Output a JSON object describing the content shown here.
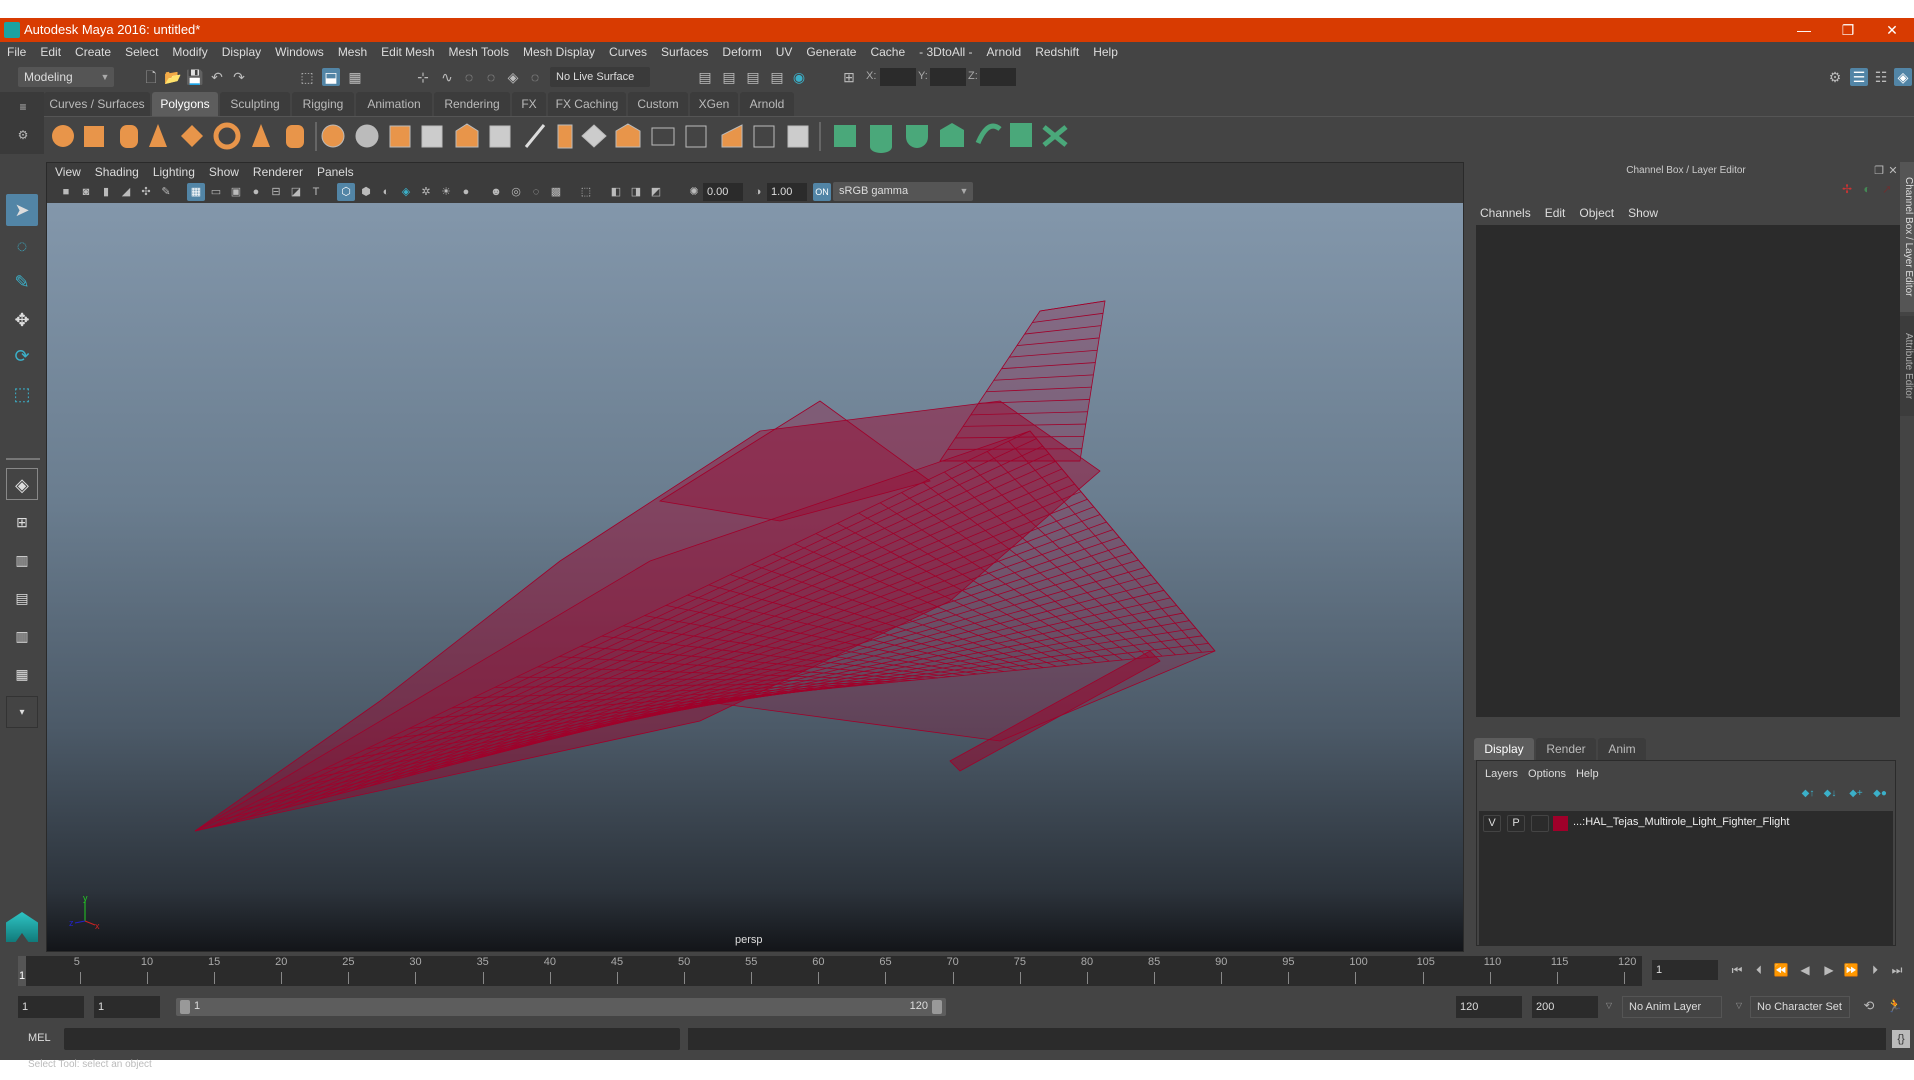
{
  "window": {
    "title": "Autodesk Maya 2016: untitled*",
    "minimize": "—",
    "restore": "❐",
    "close": "✕"
  },
  "menubar": [
    "File",
    "Edit",
    "Create",
    "Select",
    "Modify",
    "Display",
    "Windows",
    "Mesh",
    "Edit Mesh",
    "Mesh Tools",
    "Mesh Display",
    "Curves",
    "Surfaces",
    "Deform",
    "UV",
    "Generate",
    "Cache",
    "- 3DtoAll -",
    "Arnold",
    "Redshift",
    "Help"
  ],
  "statusline": {
    "mode": "Modeling",
    "live_surface": "No Live Surface",
    "x_label": "X:",
    "y_label": "Y:",
    "z_label": "Z:",
    "x_value": "",
    "y_value": "",
    "z_value": ""
  },
  "shelf": {
    "tabs": [
      {
        "label": "Curves / Surfaces",
        "active": false
      },
      {
        "label": "Polygons",
        "active": true
      },
      {
        "label": "Sculpting",
        "active": false
      },
      {
        "label": "Rigging",
        "active": false
      },
      {
        "label": "Animation",
        "active": false
      },
      {
        "label": "Rendering",
        "active": false
      },
      {
        "label": "FX",
        "active": false
      },
      {
        "label": "FX Caching",
        "active": false
      },
      {
        "label": "Custom",
        "active": false
      },
      {
        "label": "XGen",
        "active": false
      },
      {
        "label": "Arnold",
        "active": false
      }
    ]
  },
  "viewport": {
    "menu": [
      "View",
      "Shading",
      "Lighting",
      "Show",
      "Renderer",
      "Panels"
    ],
    "exposure": "0.00",
    "gamma": "1.00",
    "color_space": "sRGB gamma",
    "camera_label": "persp",
    "axis": {
      "x": "x",
      "y": "y",
      "z": "z"
    },
    "wire_color": "#a0002a"
  },
  "channel_box": {
    "title": "Channel Box / Layer Editor",
    "menu": [
      "Channels",
      "Edit",
      "Object",
      "Show"
    ],
    "side_tabs": [
      "Channel Box / Layer Editor",
      "Attribute Editor"
    ]
  },
  "layer_editor": {
    "tabs": [
      {
        "label": "Display",
        "active": true
      },
      {
        "label": "Render",
        "active": false
      },
      {
        "label": "Anim",
        "active": false
      }
    ],
    "menu": [
      "Layers",
      "Options",
      "Help"
    ],
    "layers": [
      {
        "visible": "V",
        "playback": "P",
        "name": "...:HAL_Tejas_Multirole_Light_Fighter_Flight",
        "color": "#a0002a"
      }
    ]
  },
  "timeline": {
    "ticks": [
      "5",
      "10",
      "15",
      "20",
      "25",
      "30",
      "35",
      "40",
      "45",
      "50",
      "55",
      "60",
      "65",
      "70",
      "75",
      "80",
      "85",
      "90",
      "95",
      "100",
      "105",
      "110",
      "115",
      "120"
    ],
    "current_frame_marker": "1",
    "current_frame": "1"
  },
  "range": {
    "start": "1",
    "current": "1",
    "slider_start": "1",
    "slider_end": "120",
    "end": "120",
    "max": "200",
    "anim_layer": "No Anim Layer",
    "character_set": "No Character Set"
  },
  "command": {
    "language": "MEL",
    "input": "",
    "result": ""
  },
  "help_line": "Select Tool: select an object"
}
